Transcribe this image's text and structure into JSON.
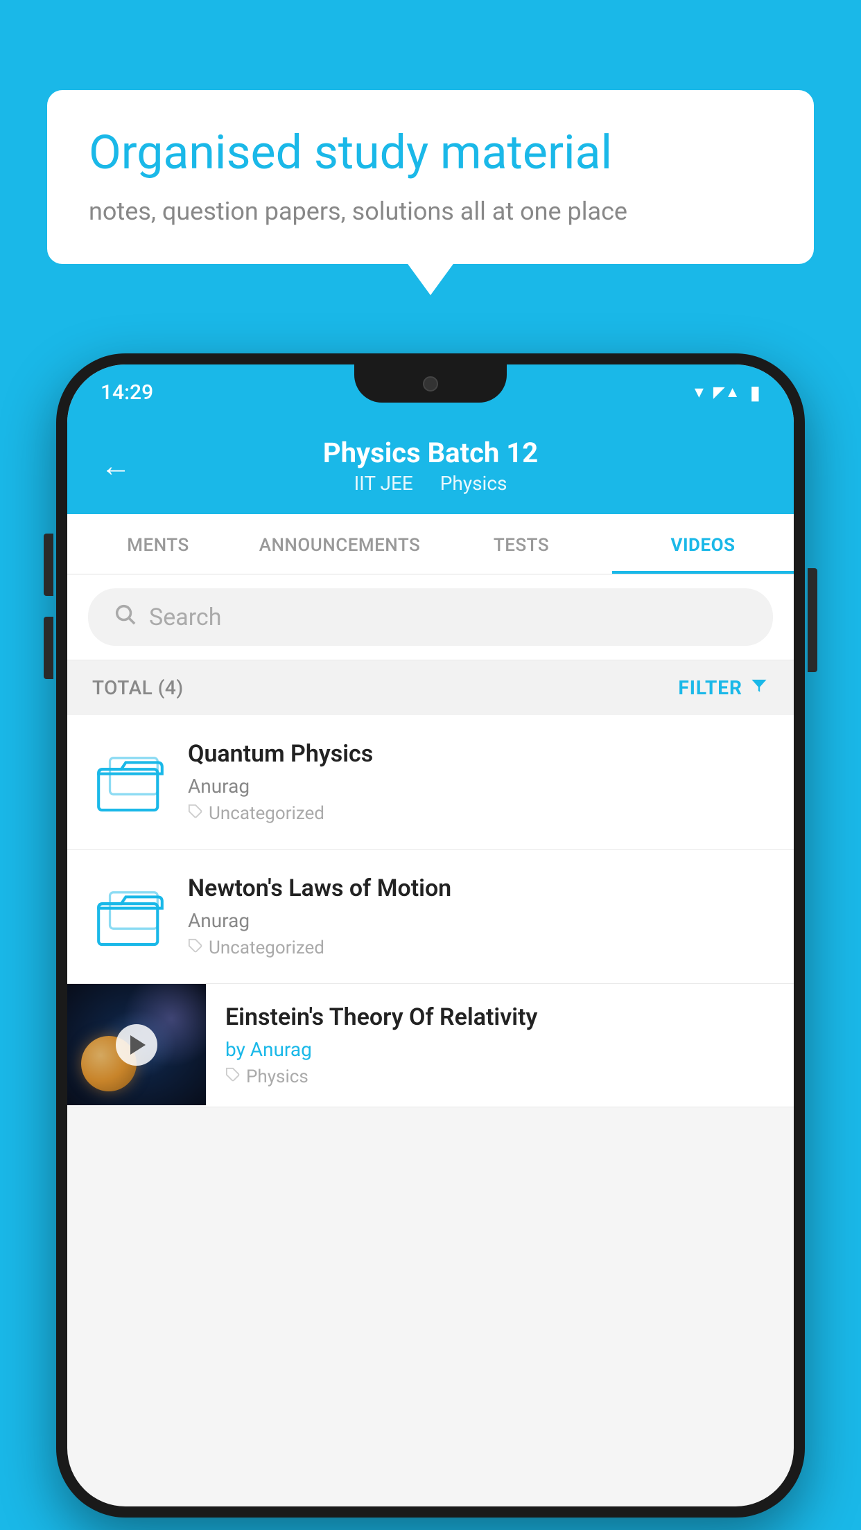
{
  "background_color": "#1ab8e8",
  "bubble": {
    "title": "Organised study material",
    "subtitle": "notes, question papers, solutions all at one place"
  },
  "phone": {
    "status_bar": {
      "time": "14:29"
    },
    "header": {
      "title": "Physics Batch 12",
      "subtitle_part1": "IIT JEE",
      "subtitle_part2": "Physics",
      "back_label": "←"
    },
    "tabs": [
      {
        "label": "MENTS",
        "active": false
      },
      {
        "label": "ANNOUNCEMENTS",
        "active": false
      },
      {
        "label": "TESTS",
        "active": false
      },
      {
        "label": "VIDEOS",
        "active": true
      }
    ],
    "search": {
      "placeholder": "Search"
    },
    "filter_bar": {
      "total_label": "TOTAL (4)",
      "filter_label": "FILTER"
    },
    "videos": [
      {
        "id": 1,
        "title": "Quantum Physics",
        "author": "Anurag",
        "tag": "Uncategorized",
        "type": "folder"
      },
      {
        "id": 2,
        "title": "Newton's Laws of Motion",
        "author": "Anurag",
        "tag": "Uncategorized",
        "type": "folder"
      },
      {
        "id": 3,
        "title": "Einstein's Theory Of Relativity",
        "author": "Anurag",
        "tag": "Physics",
        "type": "video",
        "by_prefix": "by "
      }
    ]
  }
}
